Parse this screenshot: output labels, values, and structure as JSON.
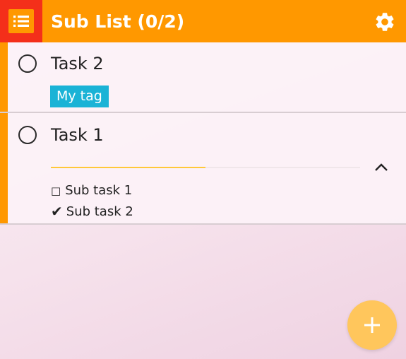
{
  "header": {
    "title": "Sub List (0/2)",
    "menu_icon": "list-icon",
    "settings_icon": "gear-icon",
    "color": "#ff9800"
  },
  "tasks": [
    {
      "title": "Task 2",
      "tags": [
        "My tag"
      ],
      "completed": false
    },
    {
      "title": "Task 1",
      "completed": false,
      "progress": 0.5,
      "expanded": true,
      "subtasks": [
        {
          "label": "Sub task 1",
          "done": false,
          "marker": "□"
        },
        {
          "label": "Sub task 2",
          "done": true,
          "marker": "✔"
        }
      ]
    }
  ],
  "fab": {
    "icon": "plus-icon",
    "color": "#ffc65c"
  },
  "colors": {
    "accent": "#ff9800",
    "menu_highlight": "#f42f1a",
    "tag": "#1ab3d6",
    "progress": "#ffc83a"
  }
}
